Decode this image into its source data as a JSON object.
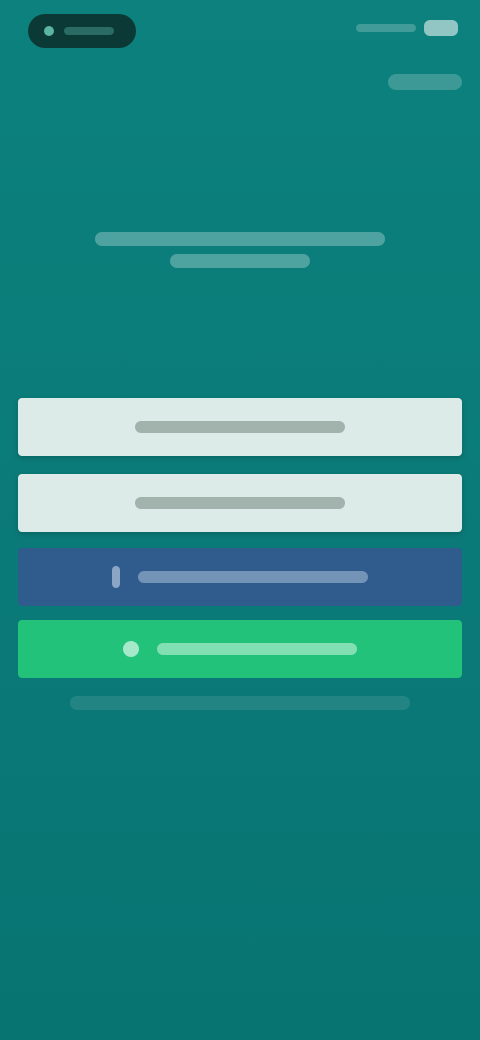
{
  "colors": {
    "background": "#0a7a78",
    "light_button": "#dcebe7",
    "facebook_button": "#2f5b8d",
    "whatsapp_button": "#23c27a"
  },
  "icons": {
    "facebook": "facebook-icon",
    "whatsapp": "whatsapp-icon"
  }
}
